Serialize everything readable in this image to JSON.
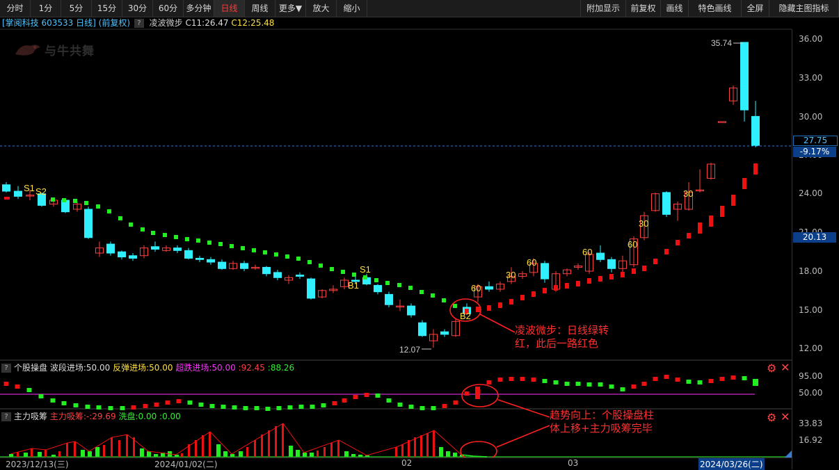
{
  "toolbar": {
    "left": [
      "分时",
      "1分",
      "5分",
      "15分",
      "30分",
      "60分",
      "多分钟",
      "日线",
      "周线",
      "更多▼",
      "放大",
      "缩小"
    ],
    "right": [
      "附加显示",
      "前复权",
      "画线",
      "特色画线",
      "全屏",
      "隐藏主图指标"
    ]
  },
  "stock": {
    "name": "[掌阅科技 603533 日线]",
    "adj": "(前复权)",
    "help": "?",
    "indicator": "凌波微步",
    "c1": "C11:26.47",
    "c2": "C12:25.48"
  },
  "watermark": "与牛共舞",
  "price_axis": {
    "ticks": [
      "36.00",
      "33.00",
      "30.00",
      "27.00",
      "24.00",
      "21.00",
      "18.00",
      "15.00",
      "12.00"
    ],
    "current": "27.75",
    "change": "-9.17%",
    "crosshair": "20.13",
    "high_label": "35.74",
    "low_label": "12.07"
  },
  "signals": {
    "s1": "S1",
    "s2": "S2",
    "s1b": "S1",
    "b1": "B1",
    "b2": "B2",
    "n60": "60",
    "n30": "30"
  },
  "panel2": {
    "help": "?",
    "title": "个股操盘",
    "a": "波段进场:50.00",
    "b": "反弹进场:50.00",
    "c": "超跌进场:50.00",
    "d": ":92.45",
    "e": ":88.26",
    "ticks": [
      "95.00",
      "50.00"
    ]
  },
  "panel3": {
    "help": "?",
    "title": "主力吸筹",
    "a": "主力吸筹:-",
    "b": ":29.69",
    "c": "洗盘:0.00",
    "d": ":0.00",
    "ticks": [
      "33.83",
      "16.92"
    ]
  },
  "dates": [
    "2023/12/13(三)",
    "2024/01/02(二)",
    "02",
    "03",
    "2024/03/26(二)"
  ],
  "annotations": {
    "a1_line1": "凌波微步：日线绿转",
    "a1_line2": "红，此后一路红色",
    "a2_line1": "趋势向上：个股操盘柱",
    "a2_line2": "体上移+主力吸筹完毕"
  },
  "colors": {
    "up": "#ff4040",
    "down": "#30f0ff",
    "green": "#22ee22",
    "red": "#ee1111",
    "yellow": "#ffe040",
    "magenta": "#ff33ff"
  }
}
